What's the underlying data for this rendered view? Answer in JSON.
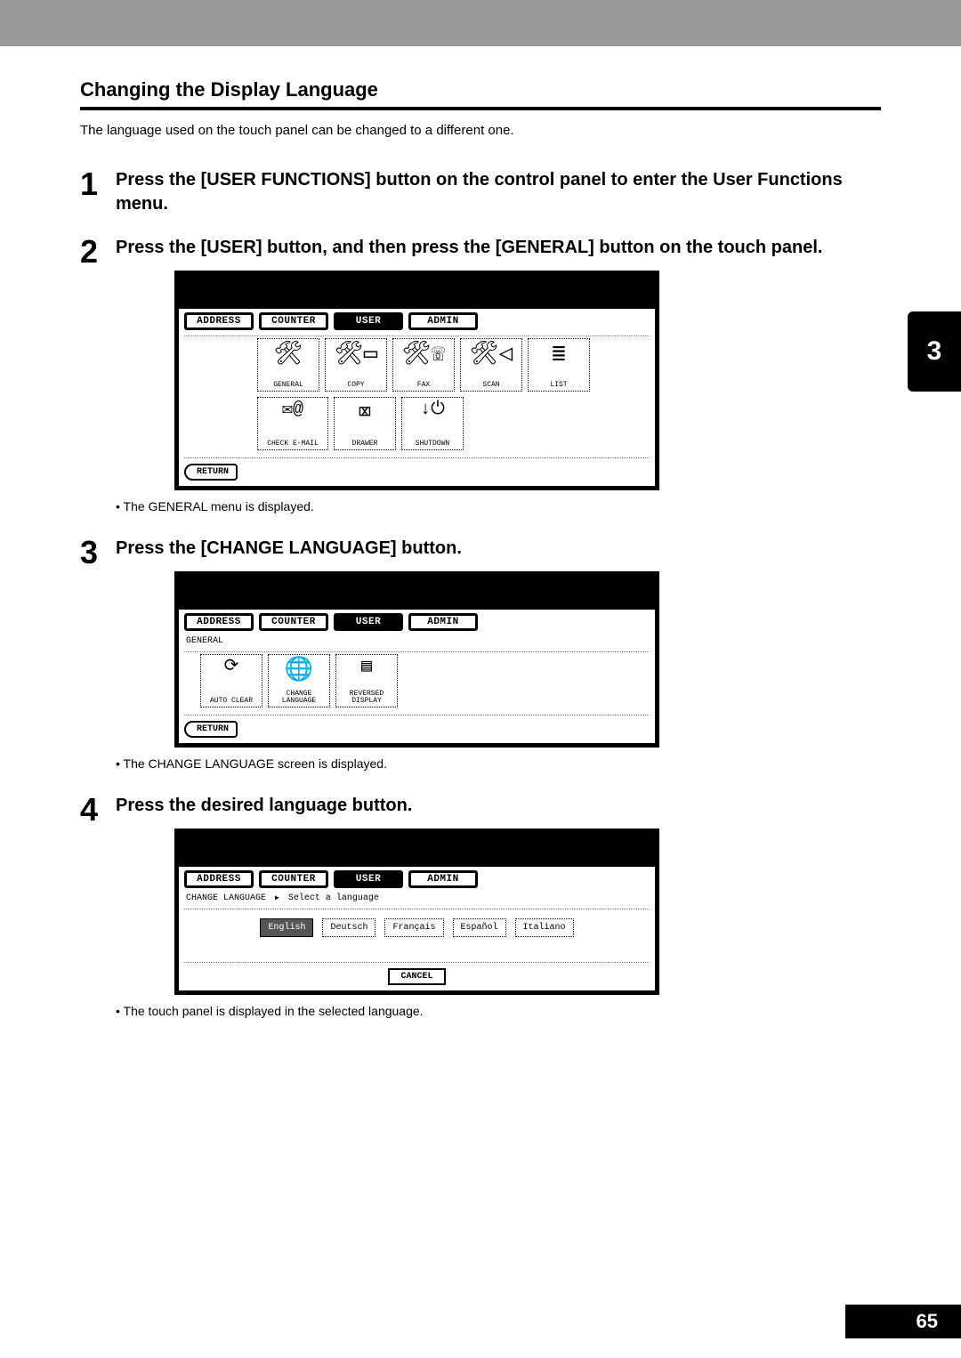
{
  "chapter_number": "3",
  "page_number": "65",
  "section_title": "Changing the Display Language",
  "intro": "The language used on the touch panel can be changed to a different one.",
  "steps": {
    "s1": {
      "num": "1",
      "text": "Press the [USER FUNCTIONS] button on the control panel to enter the User Functions menu."
    },
    "s2": {
      "num": "2",
      "text": "Press the [USER] button, and then press the [GENERAL] button on the touch panel.",
      "note": "The GENERAL menu is displayed."
    },
    "s3": {
      "num": "3",
      "text": "Press the [CHANGE LANGUAGE] button.",
      "note": "The CHANGE LANGUAGE screen is displayed."
    },
    "s4": {
      "num": "4",
      "text": "Press the desired language button.",
      "note": "The touch panel is displayed in the selected language."
    }
  },
  "tabs": {
    "address": "ADDRESS",
    "counter": "COUNTER",
    "user": "USER",
    "admin": "ADMIN"
  },
  "panel1": {
    "icons": {
      "general": "GENERAL",
      "copy": "COPY",
      "fax": "FAX",
      "scan": "SCAN",
      "list": "LIST",
      "check_email": "CHECK E-MAIL",
      "drawer": "DRAWER",
      "shutdown": "SHUTDOWN"
    },
    "return": "RETURN"
  },
  "panel2": {
    "heading": "GENERAL",
    "icons": {
      "auto_clear": "AUTO CLEAR",
      "change_language": "CHANGE\nLANGUAGE",
      "reversed_display": "REVERSED\nDISPLAY"
    },
    "return": "RETURN"
  },
  "panel3": {
    "crumb_left": "CHANGE LANGUAGE",
    "crumb_right": "Select a language",
    "langs": {
      "english": "English",
      "deutsch": "Deutsch",
      "francais": "Français",
      "espanol": "Español",
      "italiano": "Italiano"
    },
    "cancel": "CANCEL"
  }
}
